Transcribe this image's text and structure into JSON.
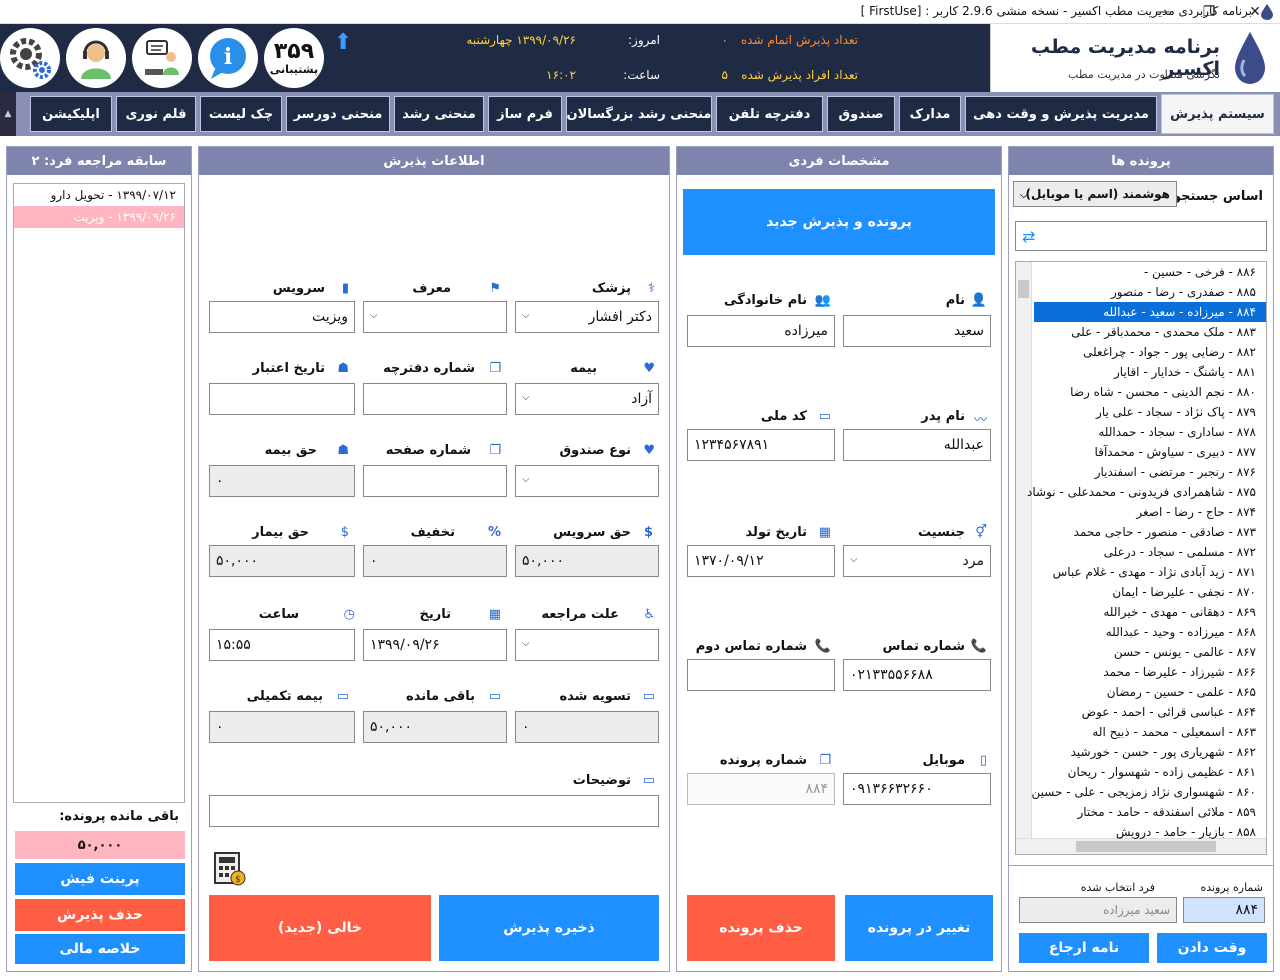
{
  "window": {
    "title": "برنامه کاربردی مدیریت مطب اکسیر - نسخه منشی 2.9.6 کاربر : [FirstUse ]",
    "minimize": "—",
    "maximize": "❐",
    "close": "✕"
  },
  "header": {
    "brand_title": "برنامه مدیریت مطب اکسیر",
    "brand_subtitle": "نگرشی متفاوت در مدیریت مطب",
    "completed_label": "تعداد پذیرش اتمام شده",
    "completed_value": "۰",
    "admitted_label": "تعداد افراد پذیرش شده",
    "admitted_value": "۵",
    "today_label": "امروز:",
    "today_value": "۱۳۹۹/۰۹/۲۶ چهارشنبه",
    "time_label": "ساعت:",
    "time_value": "۱۶:۰۲",
    "support_number": "۳۵۹",
    "support_label": "پشتیبانی",
    "up_arrow": "⬆"
  },
  "nav": {
    "tabs": [
      "سیستم پذیرش",
      "مدیریت پذیرش و وقت دهی",
      "مدارک",
      "صندوق",
      "دفترچه تلفن",
      "منحنی رشد بزرگسالان",
      "فرم ساز",
      "منحنی رشد",
      "منحنی دورسر",
      "چک لیست",
      "قلم نوری",
      "اپلیکیشن"
    ],
    "scroll_up": "▲",
    "scroll_down": "▼"
  },
  "files_panel": {
    "title": "پرونده ها",
    "search_label": "اساس جستجو",
    "search_mode": "هوشمند (اسم یا موبایل)",
    "patients": [
      "۸۸۶ - فرخی - حسین -",
      "۸۸۵ - صفدری - رضا - منصور",
      "۸۸۴ - میرزاده - سعید - عبدالله",
      "۸۸۳ - ملک محمدی - محمدباقر - علی",
      "۸۸۲ - رضایی پور - جواد - چراغعلی",
      "۸۸۱ - یاشنگ - خدایار - اقایار",
      "۸۸۰ - نجم الدینی - محسن - شاه رضا",
      "۸۷۹ - پاک نژاد - سجاد - علی یار",
      "۸۷۸ - ساداری - سجاد - حمدالله",
      "۸۷۷ - دبیری - سیاوش - محمدآقا",
      "۸۷۶ - رنجبر - مرتضی - اسفندیار",
      "۸۷۵ - شاهمرادی فریدونی - محمدعلی - نوشاد",
      "۸۷۴ - حاج - رضا - اصغر",
      "۸۷۳ - صادقی - منصور - حاجی محمد",
      "۸۷۲ - مسلمی - سجاد - درعلی",
      "۸۷۱ - زید آبادی نژاد - مهدی - غلام عباس",
      "۸۷۰ - نجفی - علیرضا - ایمان",
      "۸۶۹ - دهقانی - مهدی - خیرالله",
      "۸۶۸ - میرزاده - وحید - عبدالله",
      "۸۶۷ - عالمی - یونس - حسن",
      "۸۶۶ - شیرزاد - علیرضا - محمد",
      "۸۶۵ - علمی - حسین - رمضان",
      "۸۶۴ - عباسی قرائی - احمد - عوض",
      "۸۶۳ - اسمعیلی - محمد - ذبیح اله",
      "۸۶۲ - شهریاری پور - حسن - خورشید",
      "۸۶۱ - عظیمی زاده - شهسوار - ریحان",
      "۸۶۰ - شهسواری نژاد زمزیجی - علی - حسین",
      "۸۵۹ - ملائی اسفندقه - حامد - مختار",
      "۸۵۸ - بازیار - حامد - درویش"
    ],
    "selected_index": 2,
    "file_number_label": "شماره پرونده",
    "selected_person_label": "فرد انتخاب شده",
    "file_number_value": "۸۸۴",
    "selected_person_value": "سعید میرزاده",
    "appointment_button": "وقت دادن",
    "referral_button": "نامه ارجاع"
  },
  "personal_panel": {
    "title": "مشخصات فردی",
    "new_button": "پرونده و پذیرش جدید",
    "first_name_label": "نام",
    "first_name": "سعید",
    "last_name_label": "نام خانوادگی",
    "last_name": "میرزاده",
    "father_label": "نام پدر",
    "father": "عبدالله",
    "national_id_label": "کد ملی",
    "national_id": "۱۲۳۴۵۶۷۸۹۱",
    "gender_label": "جنسیت",
    "gender": "مرد",
    "birth_label": "تاریخ تولد",
    "birth": "۱۳۷۰/۰۹/۱۲",
    "phone_label": "شماره تماس",
    "phone": "۰۲۱۳۳۵۵۶۶۸۸",
    "phone2_label": "شماره تماس دوم",
    "phone2": "",
    "mobile_label": "موبایل",
    "mobile": "۰۹۱۳۶۶۳۲۶۶۰",
    "file_no_label": "شماره پرونده",
    "file_no": "۸۸۴",
    "edit_button": "تغییر در پرونده",
    "delete_button": "حذف پرونده"
  },
  "admission_panel": {
    "title": "اطلاعات پذیرش",
    "doctor_label": "پزشک",
    "doctor": "دکتر افشار",
    "referrer_label": "معرف",
    "referrer": "",
    "service_label": "سرویس",
    "service": "ویزیت",
    "insurance_label": "بیمه",
    "insurance": "آزاد",
    "booklet_label": "شماره دفترچه",
    "booklet": "",
    "validity_label": "تاریخ اعتبار",
    "validity": "",
    "fund_label": "نوع صندوق",
    "fund": "",
    "page_label": "شماره صفحه",
    "page": "",
    "insurance_share_label": "حق بیمه",
    "insurance_share": "۰",
    "service_fee_label": "حق سرویس",
    "service_fee": "۵۰,۰۰۰",
    "discount_label": "تخفیف",
    "discount": "۰",
    "patient_share_label": "حق بیمار",
    "patient_share": "۵۰,۰۰۰",
    "reason_label": "علت مراجعه",
    "reason": "",
    "date_label": "تاریخ",
    "date": "۱۳۹۹/۰۹/۲۶",
    "hour_label": "ساعت",
    "hour": "۱۵:۵۵",
    "settled_label": "تسویه شده",
    "settled": "۰",
    "remaining_label": "باقی مانده",
    "remaining": "۵۰,۰۰۰",
    "supplementary_label": "بیمه تکمیلی",
    "supplementary": "۰",
    "notes_label": "توضیحات",
    "notes": "",
    "save_button": "ذخیره پذیرش",
    "clear_button": "خالی (جدید)"
  },
  "history_panel": {
    "title": "سابقه مراجعه فرد: ۲",
    "items": [
      "۱۳۹۹/۰۷/۱۲ - تحویل دارو",
      "۱۳۹۹/۰۹/۲۶ - ویزیت"
    ],
    "balance_label": "باقی مانده پرونده:",
    "balance": "۵۰,۰۰۰",
    "print_button": "پرینت فیش",
    "delete_button": "حذف پذیرش",
    "summary_button": "خلاصه مالی"
  },
  "colors": {
    "header_bg": "#1f2a44",
    "accent_blue": "#1e90ff",
    "danger": "#ff5e45",
    "panel_head": "#7e84ab"
  }
}
